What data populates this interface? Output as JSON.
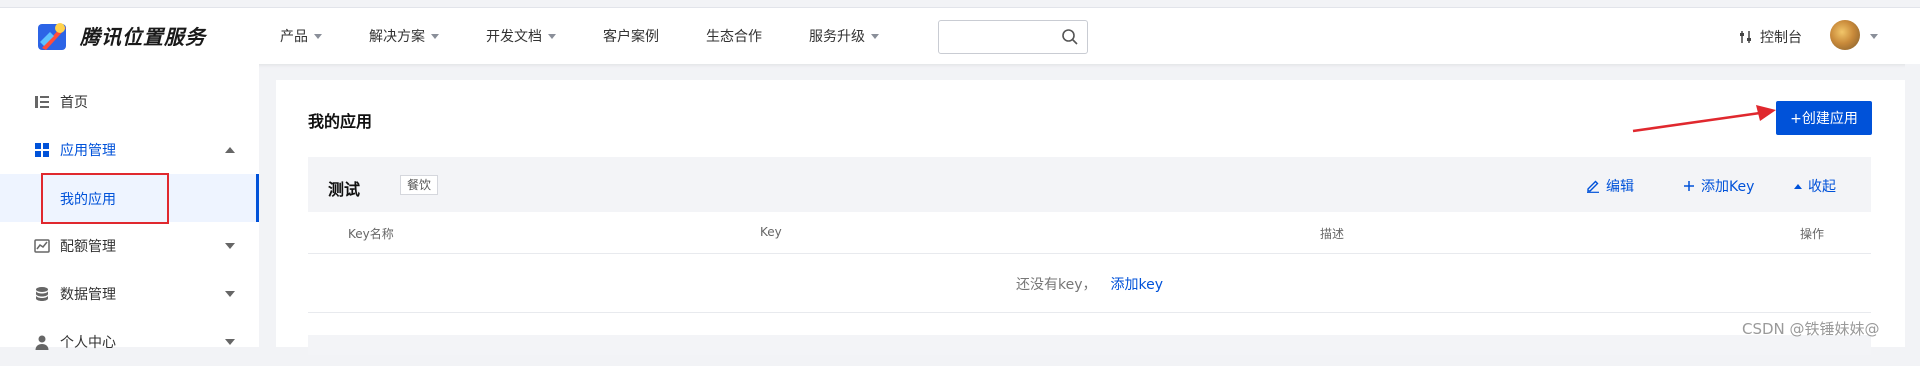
{
  "header": {
    "brand": "腾讯位置服务",
    "nav": [
      {
        "label": "产品",
        "has_dropdown": true
      },
      {
        "label": "解决方案",
        "has_dropdown": true
      },
      {
        "label": "开发文档",
        "has_dropdown": true
      },
      {
        "label": "客户案例",
        "has_dropdown": false
      },
      {
        "label": "生态合作",
        "has_dropdown": false
      },
      {
        "label": "服务升级",
        "has_dropdown": true
      }
    ],
    "search_placeholder": "",
    "console_label": "控制台"
  },
  "sidebar": {
    "items": [
      {
        "label": "首页",
        "icon": "list-icon"
      },
      {
        "label": "应用管理",
        "icon": "grid-icon"
      },
      {
        "label": "我的应用",
        "icon": ""
      },
      {
        "label": "配额管理",
        "icon": "chart-icon"
      },
      {
        "label": "数据管理",
        "icon": "database-icon"
      },
      {
        "label": "个人中心",
        "icon": "user-icon"
      }
    ]
  },
  "main": {
    "title": "我的应用",
    "create_button": "+创建应用",
    "app": {
      "name": "测试",
      "tag": "餐饮",
      "actions": {
        "edit": "编辑",
        "add_key": "添加Key",
        "collapse": "收起"
      },
      "columns": [
        "Key名称",
        "Key",
        "描述",
        "操作"
      ],
      "empty_text": "还没有key，",
      "empty_link": "添加key"
    }
  },
  "watermark": "CSDN @铁锤妹妹@",
  "colors": {
    "accent": "#0052d9",
    "highlight_box": "#e0282e"
  }
}
